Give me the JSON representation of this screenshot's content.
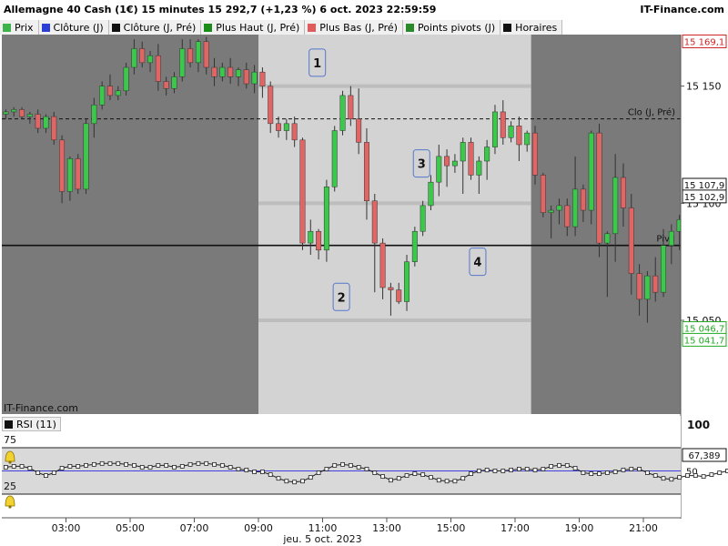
{
  "header": {
    "title": "Allemagne 40 Cash (1€) 15 minutes 15 292,7 (+1,23 %) 6 oct. 2023 22:59:59",
    "brand": "IT-Finance.com"
  },
  "legend": [
    {
      "label": "Prix",
      "color": "#3cb44b"
    },
    {
      "label": "Clôture (J)",
      "color": "#2b3fd6"
    },
    {
      "label": "Clôture (J, Pré)",
      "color": "#111111"
    },
    {
      "label": "Plus Haut (J, Pré)",
      "color": "#1a8c1a"
    },
    {
      "label": "Plus Bas (J, Pré)",
      "color": "#e05c5c"
    },
    {
      "label": "Points pivots (J)",
      "color": "#2a8a2a"
    },
    {
      "label": "Horaires",
      "color": "#111111"
    }
  ],
  "watermark": "IT-Finance.com",
  "colors": {
    "up": "#3cc84b",
    "down": "#e06666",
    "wick": "#333333",
    "session_shade": "#7a7a7a",
    "session_light": "#d3d3d3",
    "rsi_line": "#4040e0",
    "high_label": "#cc2222",
    "low_label": "#22aa22"
  },
  "rsi": {
    "label": "RSI (11)",
    "level_hi": "75",
    "level_lo": "25",
    "scale_top": "100",
    "mid": "50",
    "current": "67,389",
    "values": [
      54,
      55,
      55,
      53,
      48,
      45,
      48,
      53,
      55,
      55,
      56,
      57,
      58,
      58,
      58,
      57,
      56,
      54,
      54,
      56,
      56,
      54,
      55,
      57,
      58,
      58,
      57,
      56,
      54,
      52,
      51,
      49,
      49,
      46,
      42,
      39,
      38,
      39,
      43,
      48,
      52,
      56,
      57,
      56,
      54,
      52,
      48,
      44,
      40,
      42,
      45,
      47,
      46,
      43,
      40,
      39,
      39,
      42,
      47,
      50,
      51,
      50,
      50,
      51,
      52,
      52,
      51,
      52,
      55,
      56,
      56,
      53,
      48,
      47,
      47,
      48,
      49,
      51,
      52,
      52,
      48,
      45,
      42,
      41,
      43,
      45,
      45,
      44,
      46,
      48,
      50,
      50,
      49,
      49,
      52,
      55,
      57,
      57,
      56,
      55,
      55,
      56,
      57,
      56,
      54,
      53
    ]
  },
  "chart_data": {
    "type": "candlestick",
    "title": "Allemagne 40 Cash (1€) 15 minutes",
    "y_ticks": [
      "15 150",
      "15 100",
      "15 050"
    ],
    "x_ticks": [
      "03:00",
      "05:00",
      "07:00",
      "09:00",
      "11:00",
      "13:00",
      "15:00",
      "17:00",
      "19:00",
      "21:00"
    ],
    "x_caption": "jeu. 5 oct. 2023",
    "time_start": "01:00",
    "interval_minutes": 15,
    "ylim": [
      15010,
      15172
    ],
    "session_start": "09:00",
    "session_end": "17:30",
    "levels": [
      {
        "name": "Clo (J, Pré)",
        "value": 15136,
        "style": "dashed"
      },
      {
        "name": "Piv J",
        "value": 15082,
        "style": "solid"
      }
    ],
    "axis_badges": [
      {
        "text": "15 169,1",
        "value": 15169.1,
        "kind": "high"
      },
      {
        "text": "15 107,9",
        "value": 15107.9,
        "kind": "level"
      },
      {
        "text": "15 102,9",
        "value": 15102.9,
        "kind": "level"
      },
      {
        "text": "15 046,7",
        "value": 15046.7,
        "kind": "low"
      },
      {
        "text": "15 041,7",
        "value": 15041.7,
        "kind": "low"
      }
    ],
    "annotations": [
      {
        "label": "1",
        "time": "10:45",
        "value": 15160
      },
      {
        "label": "2",
        "time": "11:30",
        "value": 15060
      },
      {
        "label": "3",
        "time": "14:00",
        "value": 15117
      },
      {
        "label": "4",
        "time": "15:45",
        "value": 15075
      }
    ],
    "candles": [
      [
        15138,
        15140,
        15136,
        15139
      ],
      [
        15139,
        15141,
        15137,
        15140
      ],
      [
        15140,
        15141,
        15136,
        15137
      ],
      [
        15137,
        15139,
        15134,
        15138
      ],
      [
        15138,
        15140,
        15130,
        15132
      ],
      [
        15132,
        15138,
        15130,
        15137
      ],
      [
        15137,
        15139,
        15125,
        15127
      ],
      [
        15127,
        15129,
        15100,
        15105
      ],
      [
        15105,
        15120,
        15101,
        15119
      ],
      [
        15119,
        15121,
        15104,
        15106
      ],
      [
        15106,
        15136,
        15104,
        15134
      ],
      [
        15134,
        15145,
        15128,
        15142
      ],
      [
        15142,
        15152,
        15140,
        15150
      ],
      [
        15150,
        15155,
        15144,
        15146
      ],
      [
        15146,
        15150,
        15144,
        15148
      ],
      [
        15148,
        15160,
        15146,
        15158
      ],
      [
        15158,
        15170,
        15155,
        15166
      ],
      [
        15166,
        15169,
        15158,
        15160
      ],
      [
        15160,
        15165,
        15156,
        15163
      ],
      [
        15163,
        15168,
        15148,
        15152
      ],
      [
        15152,
        15154,
        15146,
        15149
      ],
      [
        15149,
        15156,
        15147,
        15154
      ],
      [
        15154,
        15170,
        15152,
        15166
      ],
      [
        15166,
        15170,
        15158,
        15160
      ],
      [
        15160,
        15170,
        15156,
        15169
      ],
      [
        15169,
        15171,
        15155,
        15158
      ],
      [
        15158,
        15162,
        15150,
        15154
      ],
      [
        15154,
        15160,
        15152,
        15158
      ],
      [
        15158,
        15162,
        15151,
        15154
      ],
      [
        15154,
        15158,
        15150,
        15157
      ],
      [
        15157,
        15160,
        15149,
        15151
      ],
      [
        15151,
        15159,
        15147,
        15156
      ],
      [
        15156,
        15158,
        15145,
        15150
      ],
      [
        15150,
        15152,
        15130,
        15134
      ],
      [
        15134,
        15137,
        15128,
        15131
      ],
      [
        15131,
        15136,
        15127,
        15134
      ],
      [
        15134,
        15137,
        15124,
        15127
      ],
      [
        15127,
        15128,
        15080,
        15083
      ],
      [
        15083,
        15093,
        15078,
        15088
      ],
      [
        15088,
        15089,
        15076,
        15080
      ],
      [
        15080,
        15110,
        15075,
        15107
      ],
      [
        15107,
        15133,
        15105,
        15131
      ],
      [
        15131,
        15148,
        15129,
        15146
      ],
      [
        15146,
        15150,
        15133,
        15136
      ],
      [
        15136,
        15149,
        15121,
        15126
      ],
      [
        15126,
        15132,
        15093,
        15101
      ],
      [
        15101,
        15104,
        15062,
        15083
      ],
      [
        15083,
        15085,
        15059,
        15064
      ],
      [
        15064,
        15066,
        15052,
        15063
      ],
      [
        15063,
        15066,
        15057,
        15058
      ],
      [
        15058,
        15078,
        15054,
        15075
      ],
      [
        15075,
        15090,
        15073,
        15088
      ],
      [
        15088,
        15101,
        15086,
        15099
      ],
      [
        15099,
        15112,
        15097,
        15109
      ],
      [
        15109,
        15125,
        15103,
        15120
      ],
      [
        15120,
        15123,
        15107,
        15116
      ],
      [
        15116,
        15121,
        15113,
        15118
      ],
      [
        15118,
        15128,
        15104,
        15126
      ],
      [
        15126,
        15128,
        15110,
        15112
      ],
      [
        15112,
        15120,
        15104,
        15118
      ],
      [
        15118,
        15127,
        15110,
        15124
      ],
      [
        15124,
        15142,
        15121,
        15139
      ],
      [
        15139,
        15144,
        15125,
        15128
      ],
      [
        15128,
        15135,
        15126,
        15133
      ],
      [
        15133,
        15137,
        15118,
        15125
      ],
      [
        15125,
        15131,
        15122,
        15130
      ],
      [
        15130,
        15133,
        15108,
        15112
      ],
      [
        15112,
        15113,
        15094,
        15096
      ],
      [
        15096,
        15099,
        15085,
        15097
      ],
      [
        15097,
        15102,
        15091,
        15099
      ],
      [
        15099,
        15102,
        15086,
        15090
      ],
      [
        15090,
        15120,
        15086,
        15106
      ],
      [
        15106,
        15108,
        15092,
        15097
      ],
      [
        15097,
        15131,
        15091,
        15130
      ],
      [
        15130,
        15134,
        15077,
        15083
      ],
      [
        15083,
        15088,
        15060,
        15087
      ],
      [
        15087,
        15121,
        15075,
        15111
      ],
      [
        15111,
        15117,
        15090,
        15098
      ],
      [
        15098,
        15104,
        15061,
        15070
      ],
      [
        15070,
        15074,
        15052,
        15059
      ],
      [
        15059,
        15071,
        15049,
        15069
      ],
      [
        15069,
        15077,
        15058,
        15062
      ],
      [
        15062,
        15089,
        15060,
        15082
      ],
      [
        15082,
        15091,
        15074,
        15088
      ],
      [
        15088,
        15095,
        15080,
        15093
      ],
      [
        15093,
        15101,
        15083,
        15095
      ],
      [
        15095,
        15100,
        15086,
        15088
      ],
      [
        15088,
        15094,
        15084,
        15089
      ],
      [
        15089,
        15092,
        15068,
        15075
      ],
      [
        15075,
        15077,
        15070,
        15074
      ],
      [
        15074,
        15090,
        15069,
        15088
      ],
      [
        15088,
        15112,
        15086,
        15109
      ],
      [
        15109,
        15111,
        15100,
        15107
      ],
      [
        15107,
        15110,
        15097,
        15105
      ],
      [
        15105,
        15110,
        15100,
        15106
      ],
      [
        15106,
        15120,
        15101,
        15118
      ],
      [
        15118,
        15125,
        15104,
        15107
      ],
      [
        15107,
        15122,
        15103,
        15119
      ],
      [
        15119,
        15125,
        15110,
        15121
      ],
      [
        15121,
        15124,
        15115,
        15117
      ],
      [
        15117,
        15124,
        15116,
        15123
      ],
      [
        15123,
        15125,
        15110,
        15114
      ],
      [
        15114,
        15120,
        15106,
        15115
      ],
      [
        15115,
        15119,
        15110,
        15116
      ]
    ]
  }
}
